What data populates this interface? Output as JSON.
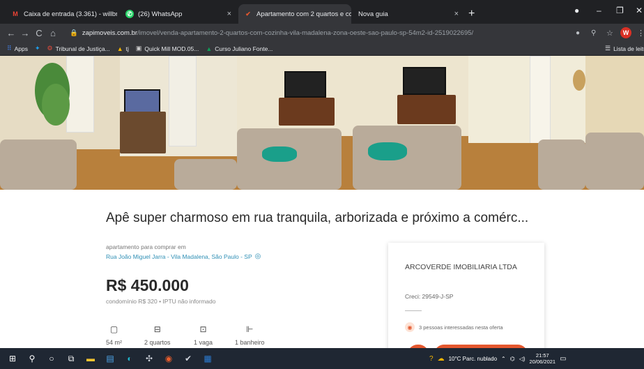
{
  "browser": {
    "tabs": [
      {
        "title": "Caixa de entrada (3.361) - willbri",
        "favicon": "gmail-icon",
        "close": "×"
      },
      {
        "title": "(26) WhatsApp",
        "favicon": "whatsapp-icon",
        "close": "×"
      },
      {
        "title": "Apartamento com 2 quartos e co",
        "favicon": "zap-icon",
        "close": "×"
      },
      {
        "title": "Nova guia",
        "favicon": "",
        "close": "×"
      }
    ],
    "new_tab": "+",
    "window_controls": {
      "minimize": "–",
      "maximize": "❐",
      "close": "✕"
    },
    "url_host": "zapimoveis.com.br",
    "url_path": "/imovel/venda-apartamento-2-quartos-com-cozinha-vila-madalena-zona-oeste-sao-paulo-sp-54m2-id-2519022695/",
    "profile_initial": "W",
    "bookmarks": [
      {
        "label": "Apps",
        "icon": "apps-grid-icon"
      },
      {
        "label": "",
        "icon": "twitter-icon"
      },
      {
        "label": "Tribunal de Justiça...",
        "icon": "tj-icon"
      },
      {
        "label": "tj",
        "icon": "bookmark-icon"
      },
      {
        "label": "Quick Mill MOD.05...",
        "icon": "quickmill-icon"
      },
      {
        "label": "Curso Juliano Fonte...",
        "icon": "drive-icon"
      }
    ],
    "reading_list": "Lista de leitura"
  },
  "listing": {
    "title": "Apê super charmoso em rua tranquila, arborizada e próximo a comérc...",
    "kind": "apartamento para comprar em",
    "address": "Rua João Miguel Jarra - Vila Madalena, São Paulo - SP",
    "price": "R$ 450.000",
    "fees": "condomínio R$ 320  •  IPTU não informado",
    "features": [
      {
        "icon": "area-icon",
        "label": "54 m²"
      },
      {
        "icon": "bed-icon",
        "label": "2 quartos"
      },
      {
        "icon": "car-icon",
        "label": "1 vaga"
      },
      {
        "icon": "shower-icon",
        "label": "1 banheiro"
      }
    ]
  },
  "agency": {
    "name": "ARCOVERDE IMOBILIARIA LTDA",
    "creci": "Creci: 29549-J-SP",
    "interest": "3 pessoas interessadas nesta oferta"
  },
  "taskbar": {
    "weather": "10°C  Parc. nublado",
    "time": "21:57",
    "date": "20/06/2021"
  },
  "colors": {
    "accent": "#e4572e",
    "link": "#2f8fb5"
  }
}
